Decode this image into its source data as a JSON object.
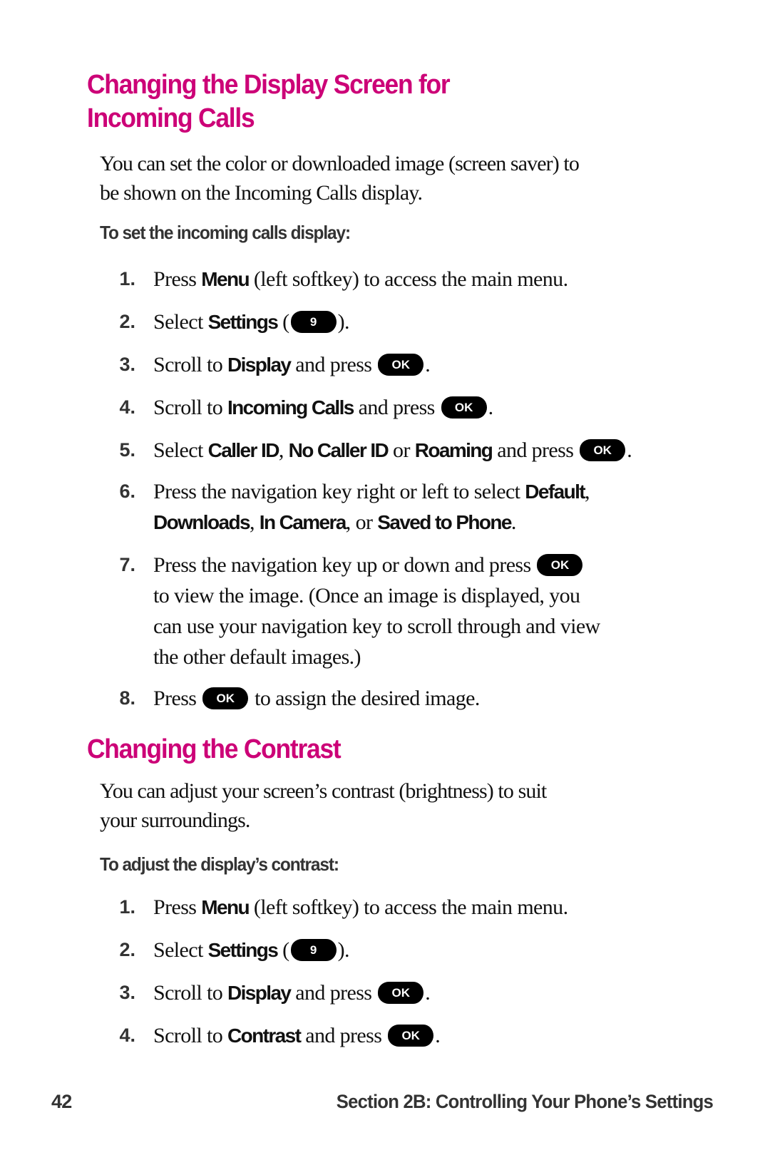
{
  "accent_color": "#CC0077",
  "section1": {
    "heading_line1": "Changing the Display Screen for",
    "heading_line2": "Incoming Calls",
    "intro_line1": "You can set the color or downloaded image (screen saver) to",
    "intro_line2": "be shown on the Incoming Calls display.",
    "subhead": "To set the incoming calls display:",
    "steps": [
      {
        "num": "1.",
        "parts": [
          "Press ",
          "Menu",
          " (left softkey) to access the main menu."
        ]
      },
      {
        "num": "2.",
        "parts": [
          "Select ",
          "Settings",
          " (",
          "9",
          ")."
        ]
      },
      {
        "num": "3.",
        "parts": [
          "Scroll to ",
          "Display",
          " and press ",
          "OK",
          "."
        ]
      },
      {
        "num": "4.",
        "parts": [
          "Scroll to ",
          "Incoming Calls",
          " and press ",
          "OK",
          "."
        ]
      },
      {
        "num": "5.",
        "parts": [
          "Select ",
          "Caller ID",
          ", ",
          "No Caller ID",
          " or ",
          "Roaming",
          " and press ",
          "OK",
          "."
        ]
      },
      {
        "num": "6.",
        "parts": [
          "Press the navigation key right or left to select ",
          "Default",
          ",",
          "Downloads",
          ", ",
          "In Camera",
          ", or ",
          "Saved to Phone",
          "."
        ]
      },
      {
        "num": "7.",
        "parts": [
          "Press the navigation key up or down and press ",
          "OK",
          "to view the image. (Once an image is displayed, you",
          "can use your navigation key to scroll through and view",
          "the other default images.)"
        ]
      },
      {
        "num": "8.",
        "parts": [
          "Press ",
          "OK",
          " to assign the desired image."
        ]
      }
    ]
  },
  "section2": {
    "heading": "Changing the Contrast",
    "intro_line1": "You can adjust your screen’s contrast (brightness) to suit",
    "intro_line2": "your surroundings.",
    "subhead": "To adjust the display’s contrast:",
    "steps": [
      {
        "num": "1.",
        "parts": [
          "Press ",
          "Menu",
          " (left softkey) to access the main menu."
        ]
      },
      {
        "num": "2.",
        "parts": [
          "Select ",
          "Settings",
          " (",
          "9",
          ")."
        ]
      },
      {
        "num": "3.",
        "parts": [
          "Scroll to ",
          "Display",
          " and press ",
          "OK",
          "."
        ]
      },
      {
        "num": "4.",
        "parts": [
          "Scroll to ",
          "Contrast",
          " and press ",
          "OK",
          "."
        ]
      }
    ]
  },
  "footer": {
    "page_number": "42",
    "section_title": "Section 2B: Controlling Your Phone’s Settings"
  }
}
